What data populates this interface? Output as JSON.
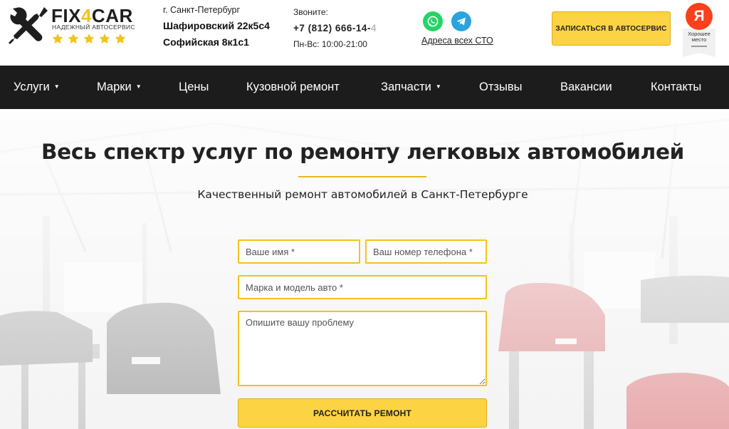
{
  "brand": {
    "name_part1": "FIX",
    "name_part2": "4",
    "name_part3": "CAR",
    "tagline": "НАДЕЖНЫЙ АВТОСЕРВИС",
    "rating_stars": 5,
    "star_color": "#f2c31b"
  },
  "address": {
    "city": "г. Санкт-Петербург",
    "lines": [
      "Шафировский 22к5с4",
      "Софийская 8к1с1"
    ]
  },
  "contacts": {
    "call_label": "Звоните:",
    "phone_visible": "+7 (812) 666-14-",
    "phone_faded": "4",
    "hours": "Пн-Вс: 10:00-21:00"
  },
  "messengers": {
    "icons": [
      "whatsapp-icon",
      "telegram-icon"
    ],
    "all_locations_link": "Адреса всех СТО"
  },
  "header_cta": {
    "label": "ЗАПИСАТЬСЯ В АВТОСЕРВИС"
  },
  "yandex_badge": {
    "letter": "Я",
    "line1": "Хорошее",
    "line2": "место"
  },
  "nav": {
    "items": [
      {
        "label": "Услуги",
        "dropdown": "▼"
      },
      {
        "label": "Марки",
        "dropdown": "▼"
      },
      {
        "label": "Цены"
      },
      {
        "label": "Кузовной ремонт"
      },
      {
        "label": "Запчасти",
        "dropdown": "▼"
      },
      {
        "label": "Отзывы"
      },
      {
        "label": "Вакансии"
      },
      {
        "label": "Контакты"
      }
    ]
  },
  "hero": {
    "title": "Весь спектр услуг по ремонту легковых автомобилей",
    "subtitle": "Качественный ремонт автомобилей в Санкт-Петербурге"
  },
  "form": {
    "name_placeholder": "Ваше имя *",
    "phone_placeholder": "Ваш номер телефона *",
    "car_placeholder": "Марка и модель авто *",
    "problem_placeholder": "Опишите вашу проблему",
    "submit_label": "РАССЧИТАТЬ РЕМОНТ"
  },
  "colors": {
    "accent": "#fcd343",
    "nav_bg": "#1c1c1c",
    "whatsapp": "#25d366",
    "telegram": "#2aa3de",
    "yandex": "#fc3f1d"
  }
}
